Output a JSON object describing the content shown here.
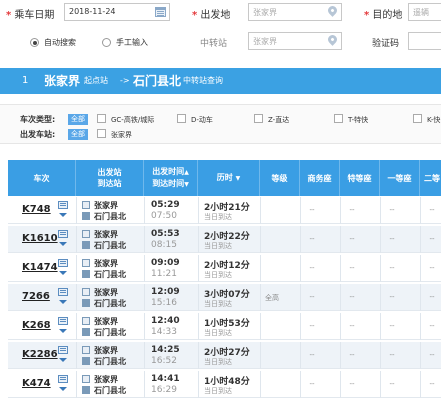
{
  "query": {
    "date_label": "乘车日期",
    "date_value": "2018-11-24",
    "from_label": "出发地",
    "from_value": "张家界",
    "to_label": "目的地",
    "to_placeholder": "遥辆",
    "required_mark": "*",
    "transfer_label": "中转站",
    "transfer_value": "张家界",
    "captcha_label": "验证码",
    "mode_auto": "自动搜索",
    "mode_manual": "手工输入"
  },
  "route": {
    "index": "1",
    "origin": "张家界",
    "origin_suffix": "起点站",
    "arrow": "->",
    "dest": "石门县北",
    "dest_suffix": "中转站查询"
  },
  "filter": {
    "type_label": "车次类型:",
    "station_label": "出发车站:",
    "all_label": "全部",
    "types": [
      "GC-高铁/城际",
      "D-动车",
      "Z-直达",
      "T-特快",
      "K-快"
    ],
    "stations": [
      "张家界"
    ]
  },
  "table": {
    "headers": {
      "train": "车次",
      "stations_1": "出发站",
      "stations_2": "到达站",
      "times_1": "出发时间",
      "times_2": "到达时间",
      "duration": "历时",
      "grade": "等级",
      "business": "商务座",
      "special": "特等座",
      "first": "一等座",
      "second": "二等"
    },
    "sort_up": "▲",
    "sort_down": "▼",
    "rows": [
      {
        "train": "K748",
        "from": "张家界",
        "to": "石门县北",
        "dep": "05:29",
        "arr": "07:50",
        "dur": "2小时21分",
        "arrday": "当日到达",
        "grade": "",
        "business": "--",
        "special": "--",
        "first": "--",
        "second": "--"
      },
      {
        "train": "K1610",
        "from": "张家界",
        "to": "石门县北",
        "dep": "05:53",
        "arr": "08:15",
        "dur": "2小时22分",
        "arrday": "当日到达",
        "grade": "",
        "business": "--",
        "special": "--",
        "first": "--",
        "second": "--"
      },
      {
        "train": "K1474",
        "from": "张家界",
        "to": "石门县北",
        "dep": "09:09",
        "arr": "11:21",
        "dur": "2小时12分",
        "arrday": "当日到达",
        "grade": "",
        "business": "--",
        "special": "--",
        "first": "--",
        "second": "--"
      },
      {
        "train": "7266",
        "from": "张家界",
        "to": "石门县北",
        "dep": "12:09",
        "arr": "15:16",
        "dur": "3小时07分",
        "arrday": "当日到达",
        "grade": "全高",
        "business": "--",
        "special": "--",
        "first": "--",
        "second": "--"
      },
      {
        "train": "K268",
        "from": "张家界",
        "to": "石门县北",
        "dep": "12:40",
        "arr": "14:33",
        "dur": "1小时53分",
        "arrday": "当日到达",
        "grade": "",
        "business": "--",
        "special": "--",
        "first": "--",
        "second": "--"
      },
      {
        "train": "K2286",
        "from": "张家界",
        "to": "石门县北",
        "dep": "14:25",
        "arr": "16:52",
        "dur": "2小时27分",
        "arrday": "当日到达",
        "grade": "",
        "business": "--",
        "special": "--",
        "first": "--",
        "second": "--"
      },
      {
        "train": "K474",
        "from": "张家界",
        "to": "石门县北",
        "dep": "14:41",
        "arr": "16:29",
        "dur": "1小时48分",
        "arrday": "当日到达",
        "grade": "",
        "business": "--",
        "special": "--",
        "first": "--",
        "second": "--"
      }
    ]
  }
}
